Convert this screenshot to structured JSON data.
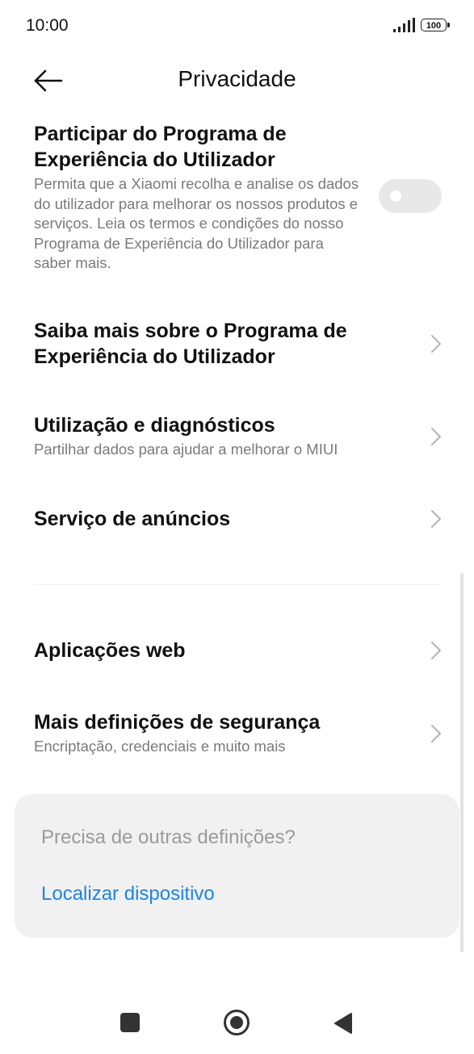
{
  "status": {
    "time": "10:00",
    "battery": "100"
  },
  "header": {
    "title": "Privacidade"
  },
  "items": [
    {
      "title": "Participar do Programa de Experiência do Utilizador",
      "subtitle": "Permita que a Xiaomi recolha e analise os dados do utilizador para melhorar os nossos produtos e serviços. Leia os termos e condições do nosso Programa de Experiência do Utilizador para saber mais.",
      "toggle_on": false
    },
    {
      "title": "Saiba mais sobre o Programa de Experiência do Utilizador"
    },
    {
      "title": "Utilização e diagnósticos",
      "subtitle": "Partilhar dados para ajudar a melhorar o MIUI"
    },
    {
      "title": "Serviço de anúncios"
    },
    {
      "title": "Aplicações web"
    },
    {
      "title": "Mais definições de segurança",
      "subtitle": "Encriptação, credenciais e muito mais"
    }
  ],
  "suggestions": {
    "heading": "Precisa de outras definições?",
    "link": "Localizar dispositivo"
  },
  "colors": {
    "accent": "#1d84e6",
    "toggle_off": "#e8e8e8"
  },
  "nav": {
    "icons": [
      "recents-square-icon",
      "home-circle-icon",
      "back-triangle-icon"
    ]
  }
}
